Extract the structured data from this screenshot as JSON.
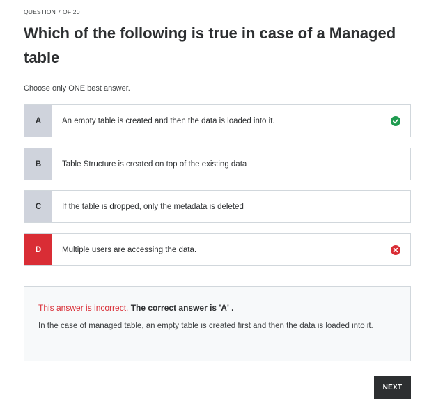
{
  "question": {
    "counter": "QUESTION 7 OF 20",
    "title": "Which of the following is true in case of a Managed table",
    "instruction": "Choose only ONE best answer."
  },
  "options": [
    {
      "letter": "A",
      "text": "An empty table is created and then the data is loaded into it.",
      "status": "correct"
    },
    {
      "letter": "B",
      "text": "Table Structure is created on top of the existing data",
      "status": "none"
    },
    {
      "letter": "C",
      "text": "If the table is dropped, only the metadata is deleted",
      "status": "none"
    },
    {
      "letter": "D",
      "text": "Multiple users are accessing the data.",
      "status": "wrong"
    }
  ],
  "feedback": {
    "incorrect_label": "This answer is incorrect.",
    "correct_answer": "The correct answer is 'A' .",
    "explanation": "In the case of managed table, an empty table is created first and then the data is loaded into it."
  },
  "actions": {
    "next_label": "NEXT"
  },
  "colors": {
    "correct": "#1e9b4f",
    "wrong": "#d92d35",
    "dark": "#2d2f31"
  },
  "icons": {
    "correct": "check-circle-icon",
    "wrong": "x-circle-icon"
  }
}
